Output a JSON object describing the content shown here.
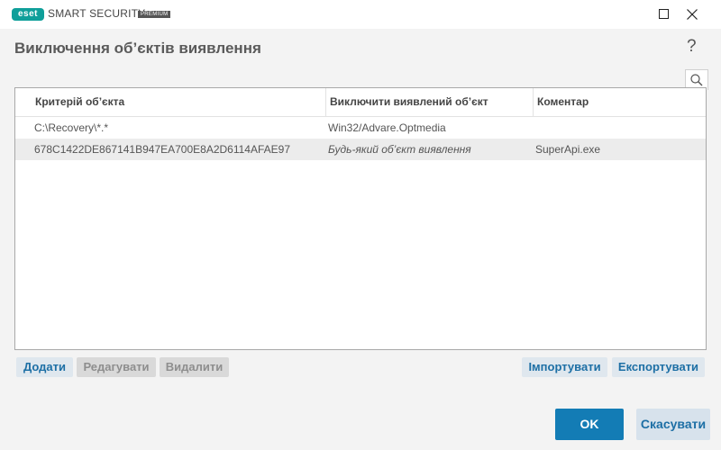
{
  "app": {
    "logo_text": "eset",
    "product_name": "SMART SECURITY",
    "edition": "PREMIUM",
    "brand_color": "#0f9f9a"
  },
  "window_controls": {
    "minimize_icon": "minimize-icon",
    "maximize_icon": "maximize-icon",
    "close_icon": "close-icon"
  },
  "header": {
    "title": "Виключення об’єктів виявлення",
    "help_label": "?"
  },
  "table": {
    "columns": [
      "Критерій об’єкта",
      "Виключити виявлений об’єкт",
      "Коментар"
    ],
    "rows": [
      {
        "criterion": "C:\\Recovery\\*.*",
        "detection": "Win32/Advare.Optmedia",
        "comment": ""
      },
      {
        "criterion": "678C1422DE867141B947EA700E8A2D6114AFAE97",
        "detection": "Будь-який об’єкт виявлення",
        "comment": "SuperApi.exe"
      }
    ]
  },
  "actions": {
    "add": "Додати",
    "edit": "Редагувати",
    "delete": "Видалити",
    "import": "Імпортувати",
    "export": "Експортувати"
  },
  "footer": {
    "ok": "OK",
    "cancel": "Скасувати"
  },
  "colors": {
    "accent": "#137cb5",
    "link": "#1d6fa5",
    "header_bg": "#f3f3f3"
  }
}
